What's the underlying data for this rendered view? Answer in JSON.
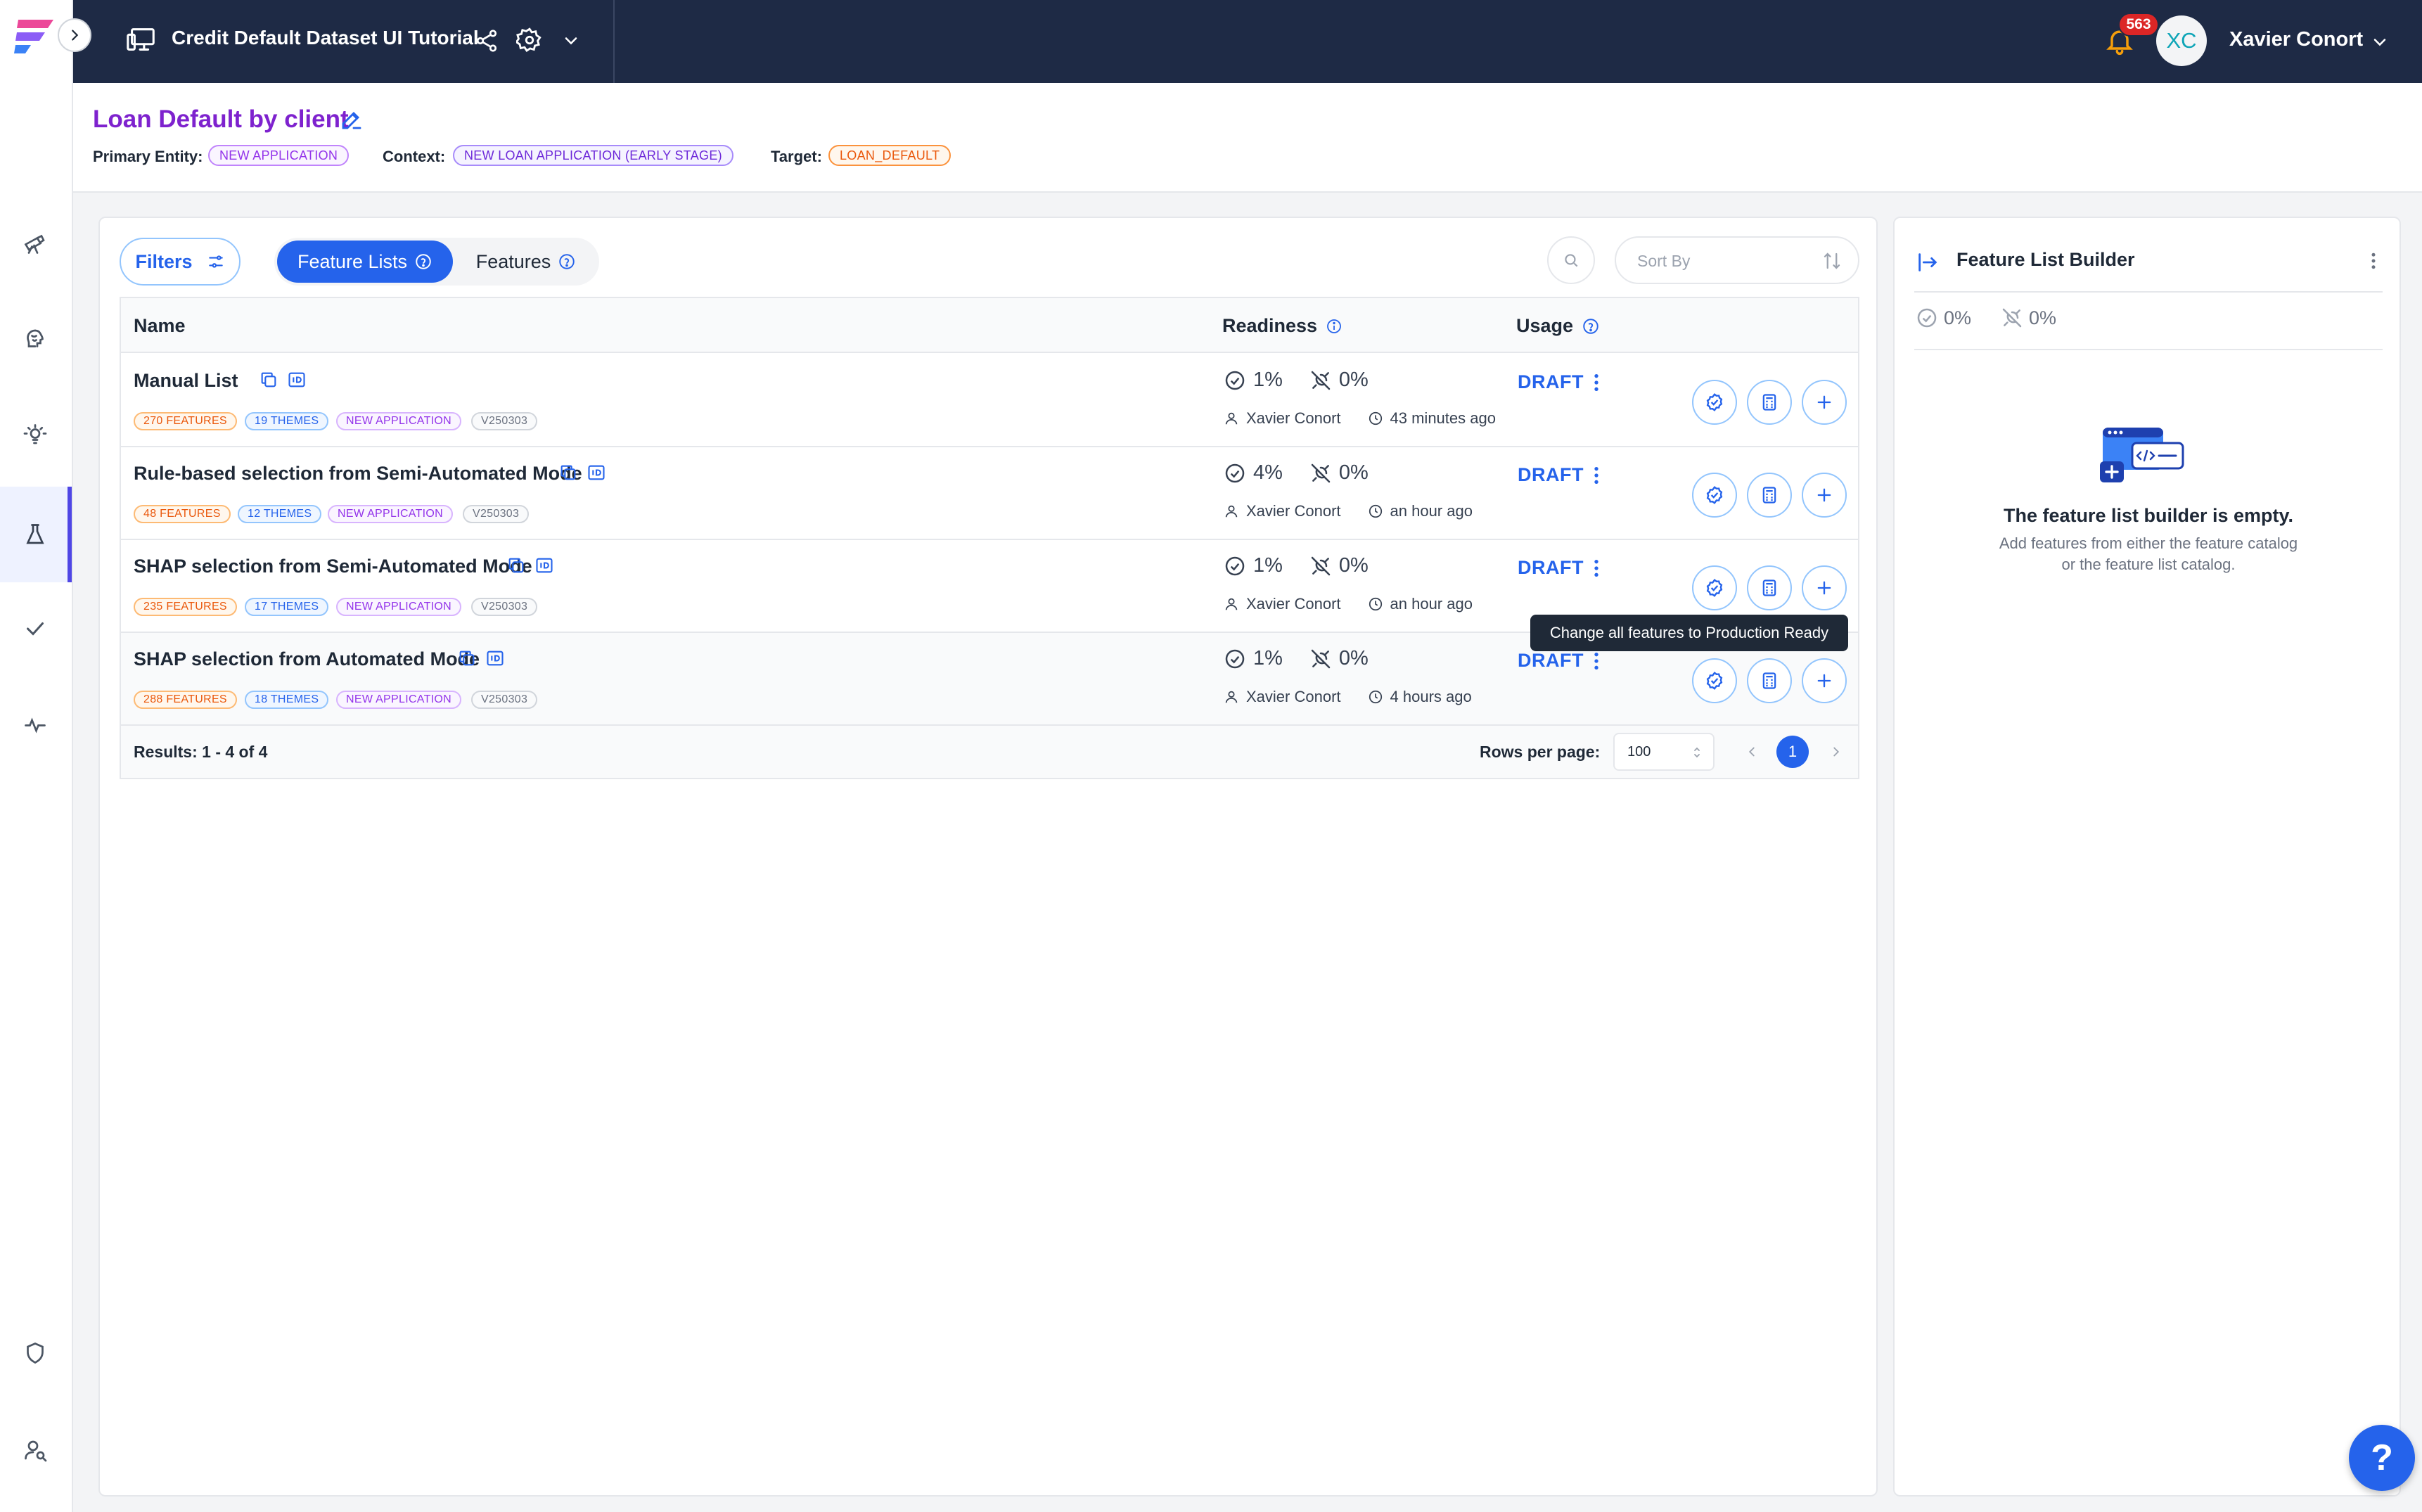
{
  "app": {
    "project_title": "Credit Default Dataset UI Tutorial",
    "notifications_count": "563",
    "user_initials": "XC",
    "user_name": "Xavier Conort",
    "colors": {
      "topbar": "#1e2a45",
      "accent": "#2563eb",
      "title": "#7e22ce",
      "danger": "#dc2626"
    }
  },
  "rail": {
    "icons": [
      "telescope-icon",
      "brain-icon",
      "lightbulb-icon",
      "flask-icon",
      "check-icon",
      "pulse-icon",
      "shield-icon",
      "user-search-icon"
    ],
    "active": "flask-icon"
  },
  "page": {
    "title": "Loan Default by client",
    "primary_entity_label": "Primary Entity:",
    "primary_entity": "NEW APPLICATION",
    "context_label": "Context:",
    "context": "NEW LOAN APPLICATION (EARLY STAGE)",
    "target_label": "Target:",
    "target": "LOAN_DEFAULT"
  },
  "toolbar": {
    "filters_label": "Filters",
    "tab_feature_lists": "Feature Lists",
    "tab_features": "Features",
    "sort_placeholder": "Sort By"
  },
  "table": {
    "headers": {
      "name": "Name",
      "readiness": "Readiness",
      "usage": "Usage"
    },
    "rows": [
      {
        "name": "Manual List",
        "features": "270 FEATURES",
        "themes": "19 THEMES",
        "entity": "NEW APPLICATION",
        "version": "V250303",
        "ready_pct": "1%",
        "online_pct": "0%",
        "owner": "Xavier Conort",
        "updated": "43 minutes ago",
        "status": "DRAFT"
      },
      {
        "name": "Rule-based selection from Semi-Automated Mode",
        "features": "48 FEATURES",
        "themes": "12 THEMES",
        "entity": "NEW APPLICATION",
        "version": "V250303",
        "ready_pct": "4%",
        "online_pct": "0%",
        "owner": "Xavier Conort",
        "updated": "an hour ago",
        "status": "DRAFT"
      },
      {
        "name": "SHAP selection from Semi-Automated Mode",
        "features": "235 FEATURES",
        "themes": "17 THEMES",
        "entity": "NEW APPLICATION",
        "version": "V250303",
        "ready_pct": "1%",
        "online_pct": "0%",
        "owner": "Xavier Conort",
        "updated": "an hour ago",
        "status": "DRAFT"
      },
      {
        "name": "SHAP selection from Automated Mode",
        "features": "288 FEATURES",
        "themes": "18 THEMES",
        "entity": "NEW APPLICATION",
        "version": "V250303",
        "ready_pct": "1%",
        "online_pct": "0%",
        "owner": "Xavier Conort",
        "updated": "4 hours ago",
        "status": "DRAFT"
      }
    ],
    "tooltip": "Change all features to Production Ready",
    "results": "Results: 1 - 4 of 4",
    "rows_per_page_label": "Rows per page:",
    "rows_per_page": "100",
    "current_page": "1"
  },
  "builder": {
    "title": "Feature List Builder",
    "ready_pct": "0%",
    "online_pct": "0%",
    "empty_title": "The feature list builder is empty.",
    "empty_line1": "Add features from either the feature catalog",
    "empty_line2": "or the feature list catalog."
  },
  "help": {
    "label": "?"
  }
}
